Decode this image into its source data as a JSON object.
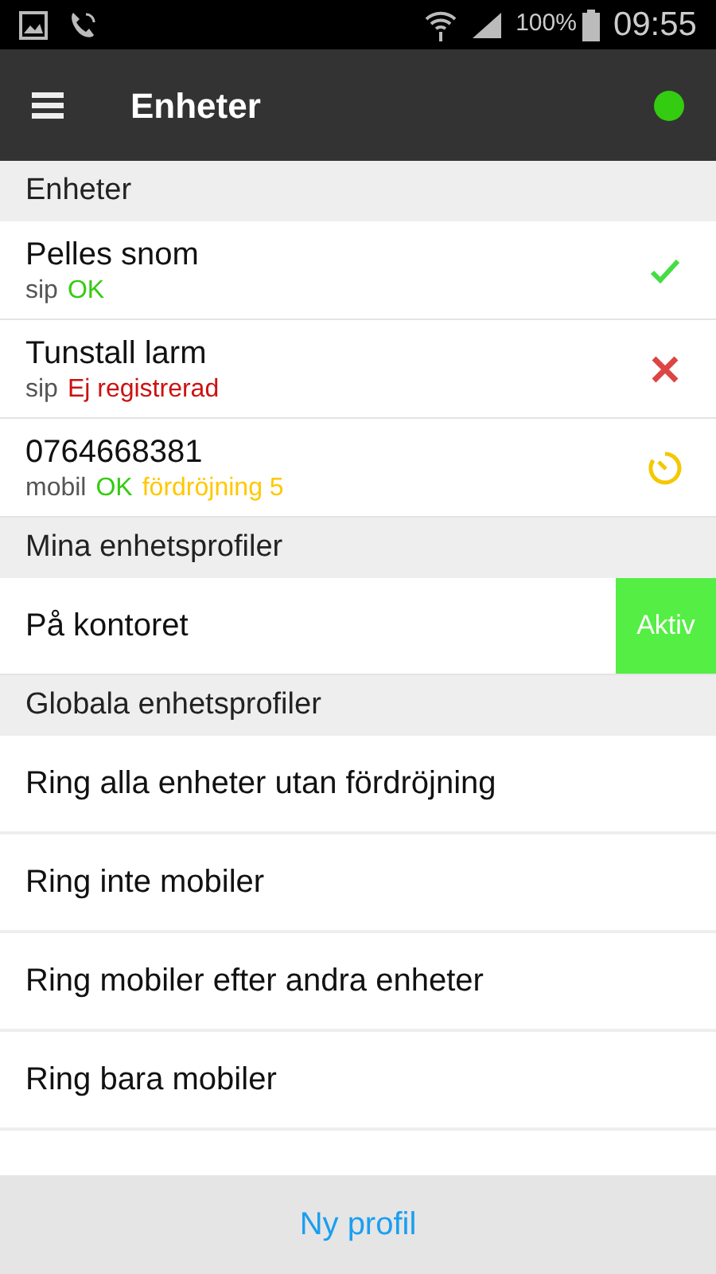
{
  "status_bar": {
    "battery": "100%",
    "time": "09:55"
  },
  "app_bar": {
    "title": "Enheter",
    "connected": true
  },
  "devices_section": {
    "title": "Enheter",
    "items": [
      {
        "name": "Pelles snom",
        "type": "sip",
        "kind": "ok",
        "parts": [
          {
            "text": "OK",
            "color": "#33cc11"
          }
        ]
      },
      {
        "name": "Tunstall larm",
        "type": "sip",
        "kind": "error",
        "parts": [
          {
            "text": "Ej registrerad",
            "color": "#cc1111"
          }
        ]
      },
      {
        "name": "0764668381",
        "type": "mobil",
        "kind": "delayed",
        "parts": [
          {
            "text": "OK",
            "color": "#33cc11"
          },
          {
            "text": "fördröjning 5",
            "color": "#ffc800"
          }
        ]
      }
    ]
  },
  "my_profiles": {
    "title": "Mina enhetsprofiler",
    "items": [
      {
        "name": "På kontoret",
        "active": true,
        "badge": "Aktiv"
      }
    ]
  },
  "global_profiles": {
    "title": "Globala enhetsprofiler",
    "items": [
      {
        "name": "Ring alla enheter utan fördröjning"
      },
      {
        "name": "Ring inte mobiler"
      },
      {
        "name": "Ring mobiler efter andra enheter"
      },
      {
        "name": "Ring bara mobiler"
      }
    ]
  },
  "footer": {
    "button": "Ny profil"
  }
}
